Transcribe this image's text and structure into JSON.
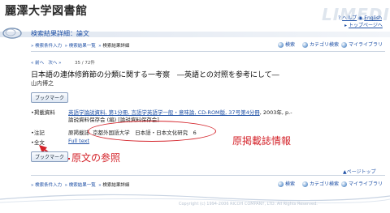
{
  "header": {
    "brand": "麗澤大学図書館",
    "watermark": "LIMEDIO",
    "help_link": "ヘルプ",
    "english_link": "English",
    "top_page_link": "トップページへ"
  },
  "page_title": "検索結果詳細：論文",
  "breadcrumb_top": [
    "検索条件入力",
    "検索結果一覧",
    "検索結果詳細"
  ],
  "right_nav": {
    "search": "検索",
    "category_search": "カテゴリ検索",
    "my_library": "マイライブラリ"
  },
  "pager": {
    "prev": "前へ",
    "next": "次へ",
    "count": "35 / 72件"
  },
  "record": {
    "title": "日本語の連体修飾節の分類に関する一考察　―英語との対照を参考にして―",
    "author": "山内博之",
    "bookmark_button": "ブックマーク",
    "fields": {
      "source_label": "掲載資料",
      "source_value": "英語学論説資料, 第1分冊, 言語学英語学一般・意味論, CD-ROM版, 37号第4分冊",
      "source_suffix": ", 2003年, p.-",
      "source_line2": "論説資料保存会 (編) [論説資料保存会]",
      "note_label": "注記",
      "note_prefix": "原掲載誌",
      "note_value": "京都外国語大学　日本語・日本文化研究　6",
      "fulltext_label": "全文",
      "fulltext_value": "Full text"
    }
  },
  "annotations": {
    "original_source": "原掲載誌情報",
    "fulltext_ref": "原文の参照"
  },
  "page_top": "ページトップ",
  "copyright": "Copyright (c) 1994-2006 RICOH COMPANY, LTD. All Rights Reserved.",
  "colors": {
    "link": "#1d4fa5",
    "annotation_red": "#d4232a"
  }
}
